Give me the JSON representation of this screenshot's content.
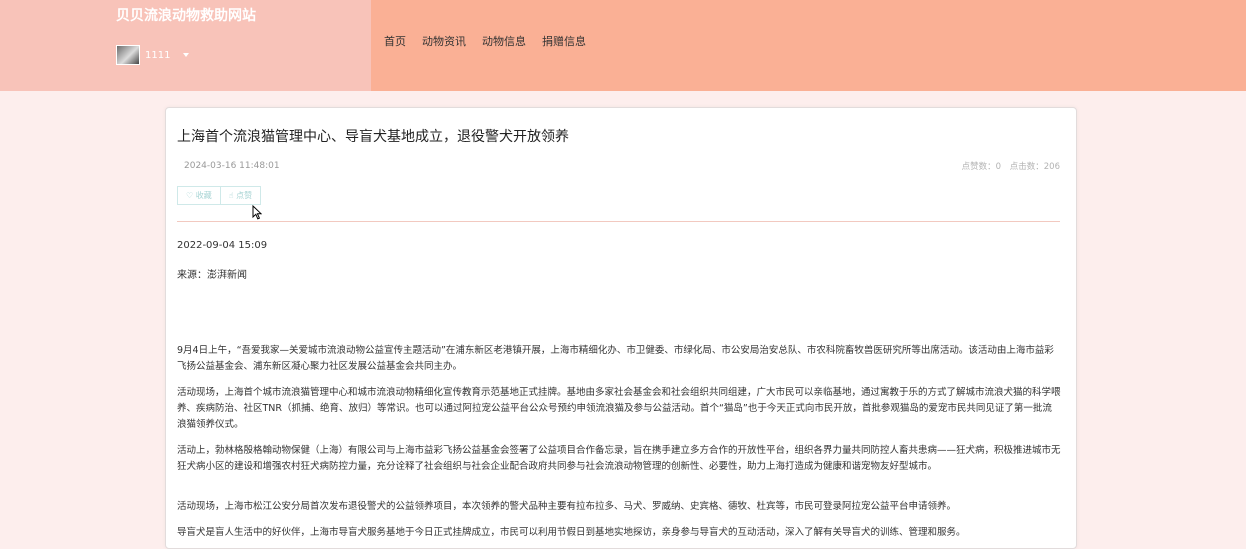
{
  "header": {
    "site_title": "贝贝流浪动物救助网站",
    "username": "1111",
    "nav": [
      "首页",
      "动物资讯",
      "动物信息",
      "捐赠信息"
    ]
  },
  "article": {
    "title": "上海首个流浪猫管理中心、导盲犬基地成立，退役警犬开放领养",
    "date": "2024-03-16 11:48:01",
    "stats": {
      "likes": "点赞数：0",
      "clicks": "点击数：206"
    },
    "buttons": {
      "favorite": "♡ 收藏",
      "like": "☝ 点赞"
    },
    "meta_date": "2022-09-04 15:09",
    "source": "来源：澎湃新闻",
    "paragraphs": [
      "9月4日上午，“吾爱我家—关爱城市流浪动物公益宣传主题活动”在浦东新区老港镇开展，上海市精细化办、市卫健委、市绿化局、市公安局治安总队、市农科院畜牧兽医研究所等出席活动。该活动由上海市益彩飞扬公益基金会、浦东新区凝心聚力社区发展公益基金会共同主办。",
      "活动现场，上海首个城市流浪猫管理中心和城市流浪动物精细化宣传教育示范基地正式挂牌。基地由多家社会基金会和社会组织共同组建，广大市民可以亲临基地，通过寓教于乐的方式了解城市流浪犬猫的科学喂养、疾病防治、社区TNR（抓捕、绝育、放归）等常识。也可以通过阿拉宠公益平台公众号预约申领流浪猫及参与公益活动。首个“猫岛”也于今天正式向市民开放，首批参观猫岛的爱宠市民共同见证了第一批流浪猫领养仪式。",
      "活动上，勃林格殷格翰动物保健（上海）有限公司与上海市益彩飞扬公益基金会签署了公益项目合作备忘录，旨在携手建立多方合作的开放性平台，组织各界力量共同防控人畜共患病——狂犬病，积极推进城市无狂犬病小区的建设和增强农村狂犬病防控力量，充分诠释了社会组织与社会企业配合政府共同参与社会流浪动物管理的创新性、必要性，助力上海打造成为健康和谐宠物友好型城市。",
      "活动现场，上海市松江公安分局首次发布退役警犬的公益领养项目，本次领养的警犬品种主要有拉布拉多、马犬、罗威纳、史宾格、德牧、杜宾等，市民可登录阿拉宠公益平台申请领养。",
      "导盲犬是盲人生活中的好伙伴，上海市导盲犬服务基地于今日正式挂牌成立，市民可以利用节假日到基地实地探访，亲身参与导盲犬的互动活动，深入了解有关导盲犬的训练、管理和服务。"
    ]
  }
}
